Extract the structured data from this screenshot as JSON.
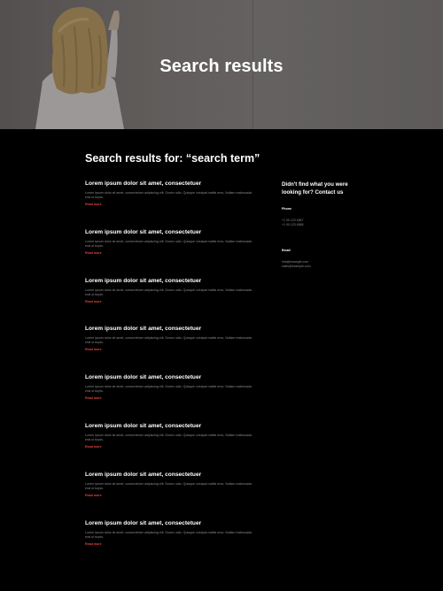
{
  "hero": {
    "title": "Search results"
  },
  "results_heading": "Search results for: “search term”",
  "results": [
    {
      "title": "Lorem ipsum dolor sit amet, consectetuer",
      "excerpt": "Lorem ipsum dolor sit amet, consectetuer adipiscing elit. Donec odio. Quisque volutpat mattis eros. Nullam malesuada erat ut turpis.",
      "link": "Read more"
    },
    {
      "title": "Lorem ipsum dolor sit amet, consectetuer",
      "excerpt": "Lorem ipsum dolor sit amet, consectetuer adipiscing elit. Donec odio. Quisque volutpat mattis eros. Nullam malesuada erat ut turpis.",
      "link": "Read more"
    },
    {
      "title": "Lorem ipsum dolor sit amet, consectetuer",
      "excerpt": "Lorem ipsum dolor sit amet, consectetuer adipiscing elit. Donec odio. Quisque volutpat mattis eros. Nullam malesuada erat ut turpis.",
      "link": "Read more"
    },
    {
      "title": "Lorem ipsum dolor sit amet, consectetuer",
      "excerpt": "Lorem ipsum dolor sit amet, consectetuer adipiscing elit. Donec odio. Quisque volutpat mattis eros. Nullam malesuada erat ut turpis.",
      "link": "Read more"
    },
    {
      "title": "Lorem ipsum dolor sit amet, consectetuer",
      "excerpt": "Lorem ipsum dolor sit amet, consectetuer adipiscing elit. Donec odio. Quisque volutpat mattis eros. Nullam malesuada erat ut turpis.",
      "link": "Read more"
    },
    {
      "title": "Lorem ipsum dolor sit amet, consectetuer",
      "excerpt": "Lorem ipsum dolor sit amet, consectetuer adipiscing elit. Donec odio. Quisque volutpat mattis eros. Nullam malesuada erat ut turpis.",
      "link": "Read more"
    },
    {
      "title": "Lorem ipsum dolor sit amet, consectetuer",
      "excerpt": "Lorem ipsum dolor sit amet, consectetuer adipiscing elit. Donec odio. Quisque volutpat mattis eros. Nullam malesuada erat ut turpis.",
      "link": "Read more"
    },
    {
      "title": "Lorem ipsum dolor sit amet, consectetuer",
      "excerpt": "Lorem ipsum dolor sit amet, consectetuer adipiscing elit. Donec odio. Quisque volutpat mattis eros. Nullam malesuada erat ut turpis.",
      "link": "Read more"
    }
  ],
  "sidebar": {
    "heading": "Didn't find what you were looking for? Contact us",
    "phone_label": "Phone",
    "phones": [
      "+1 00 123 4567",
      "+1 00 123 4568"
    ],
    "email_label": "Email",
    "emails": [
      "info@example.com",
      "sales@example.com"
    ]
  },
  "colors": {
    "background": "#000000",
    "accent": "#e0463c",
    "muted_text": "#8a8a8a"
  }
}
